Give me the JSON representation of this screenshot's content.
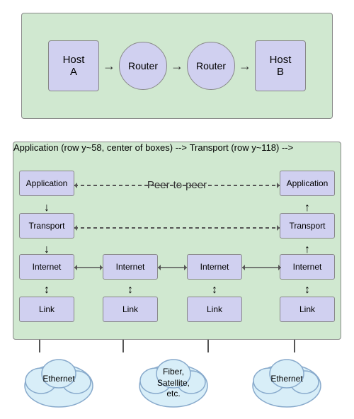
{
  "top": {
    "hostA": "Host\nA",
    "hostB": "Host\nB",
    "router1": "Router",
    "router2": "Router"
  },
  "bottom": {
    "peerLabel": "Peer-to-peer",
    "col1": {
      "app": "Application",
      "transport": "Transport",
      "internet": "Internet",
      "link": "Link"
    },
    "col2": {
      "internet": "Internet",
      "link": "Link"
    },
    "col3": {
      "internet": "Internet",
      "link": "Link"
    },
    "col4": {
      "app": "Application",
      "transport": "Transport",
      "internet": "Internet",
      "link": "Link"
    }
  },
  "clouds": {
    "left": "Ethernet",
    "middle": "Fiber,\nSatellite,\netc.",
    "right": "Ethernet"
  },
  "colors": {
    "boxFill": "#d0d0f0",
    "bgGreen": "#d0e8d0",
    "border": "#888"
  }
}
